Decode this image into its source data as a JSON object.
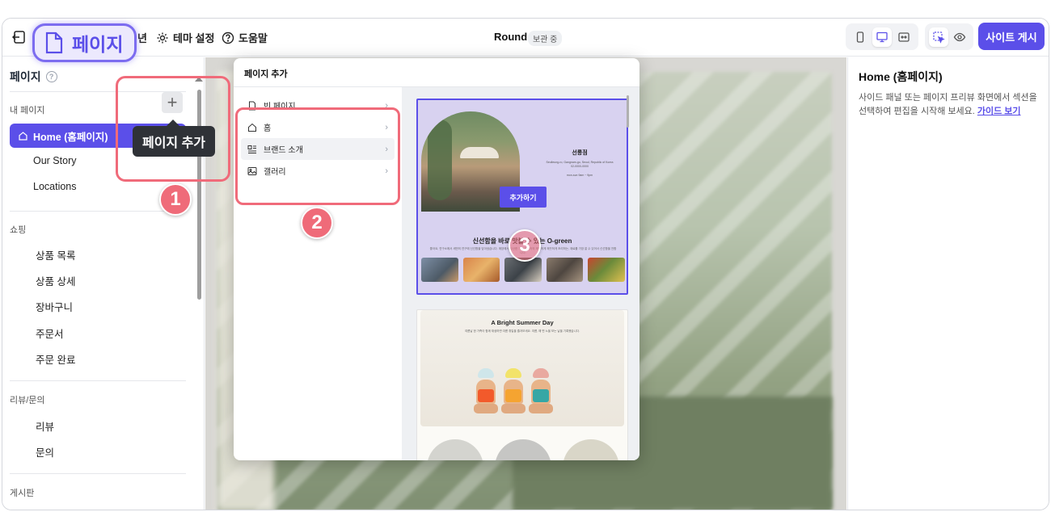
{
  "topbar": {
    "hidden_fragment": "년",
    "theme_label": "테마 설정",
    "help_label": "도움말",
    "site_title": "Round",
    "status": "보관 중",
    "publish_label": "사이트 게시"
  },
  "sidebar": {
    "title": "페이지",
    "sections": {
      "mine": "내 페이지",
      "shopping": "쇼핑",
      "review": "리뷰/문의",
      "board": "게시판"
    },
    "my_pages": [
      "Home (홈페이지)",
      "Our Story",
      "Locations"
    ],
    "shop_pages": [
      "상품 목록",
      "상품 상세",
      "장바구니",
      "주문서",
      "주문 완료"
    ],
    "review_pages": [
      "리뷰",
      "문의"
    ]
  },
  "annotation": {
    "page_label": "페이지",
    "tooltip": "페이지 추가",
    "numbers": [
      "1",
      "2",
      "3"
    ]
  },
  "modal": {
    "title": "페이지 추가",
    "list": [
      "빈 페이지",
      "홈",
      "브랜드 소개",
      "갤러리"
    ],
    "template1": {
      "name": "선릉점",
      "address": "Seolleung-ro, Gangnam-gu, Seoul, Republic of Korea",
      "phone": "02-0000-0000",
      "hours": "mon-sun 9am ~ 9pm",
      "add_button": "추가하기",
      "heading": "신선함을 바로 맛볼 수 있는 O-green",
      "body": "좋아요, 연구소에서 세번의 연구에 신선함을 담아냈습니다. 매장에서 수산한 기사 바이어의 깨끗하게 깨끗하게 조리하는, 재료를 가장 잘 수 있어서 신선함을 전합니다."
    },
    "template2": {
      "title": "A Bright Summer Day",
      "subtitle": "여름날 한 가족이 함께 재생하면 여름 휴일을 즐겨보세요. 여름, 해 변 노을 보는 날을 기록했습니다."
    }
  },
  "rpanel": {
    "title": "Home (홈페이지)",
    "desc": "사이드 패널 또는 페이지 프리뷰 화면에서 섹션을 선택하여 편집을 시작해 보세요.",
    "link": "가이드 보기"
  },
  "colors": {
    "accent": "#5b4fe9",
    "annotation": "#ef6b79"
  }
}
